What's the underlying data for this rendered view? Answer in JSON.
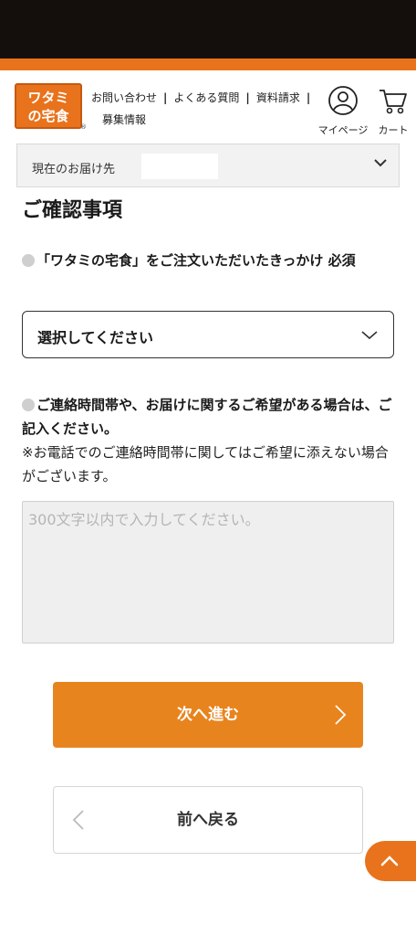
{
  "header": {
    "logo_text_top": "ワタミ",
    "logo_text_bottom": "の宅食",
    "logo_reg": "®",
    "nav": {
      "contact": "お問い合わせ",
      "faq": "よくある質問",
      "brochure": "資料請求",
      "recruit": "募集情報",
      "separator": "|"
    },
    "mypage_label": "マイページ",
    "cart_label": "カート"
  },
  "delivery": {
    "label": "現在のお届け先"
  },
  "form": {
    "section_title": "ご確認事項",
    "question1": "「ワタミの宅食」をご注文いただいたきっかけ 必須",
    "select_value": "選択してください",
    "question2": "ご連絡時間帯や、お届けに関するご希望がある場合は、ご記入ください。",
    "note": "※お電話でのご連絡時間帯に関してはご希望に添えない場合がございます。",
    "textarea_placeholder": "300文字以内で入力してください。"
  },
  "buttons": {
    "next_label": "次へ進む",
    "back_label": "前へ戻る"
  },
  "colors": {
    "brand_orange": "#e8731c",
    "button_orange": "#e8841e",
    "status_bar": "#140f0d"
  },
  "icons": {
    "mypage": "user-circle-icon",
    "cart": "cart-icon",
    "page_top": "chevron-up-icon"
  }
}
